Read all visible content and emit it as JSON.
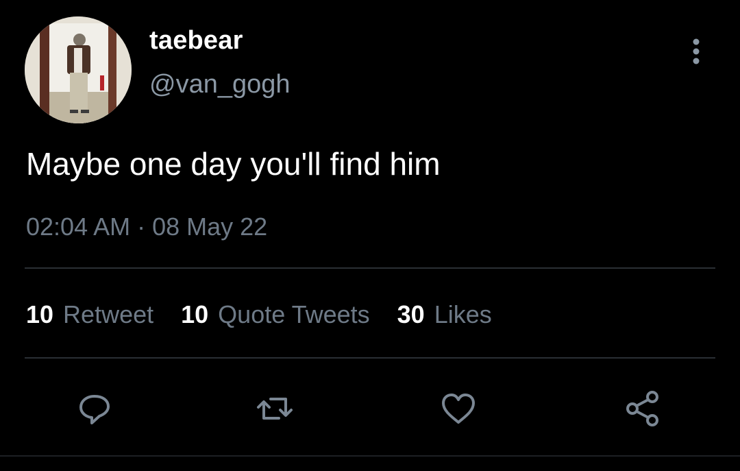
{
  "tweet": {
    "author": {
      "display_name": "taebear",
      "handle": "@van_gogh"
    },
    "text": "Maybe one day you'll find him",
    "timestamp": "02:04 AM · 08 May 22",
    "stats": {
      "retweets": {
        "count": "10",
        "label": "Retweet"
      },
      "quotes": {
        "count": "10",
        "label": "Quote Tweets"
      },
      "likes": {
        "count": "30",
        "label": "Likes"
      }
    },
    "icons": {
      "more": "more-vertical-icon",
      "reply": "reply-icon",
      "retweet": "retweet-icon",
      "like": "heart-icon",
      "share": "share-icon"
    }
  },
  "colors": {
    "background": "#000000",
    "primary_text": "#ffffff",
    "secondary_text": "#6e7a87",
    "icon": "#7b8794",
    "divider": "#2a2f34"
  }
}
